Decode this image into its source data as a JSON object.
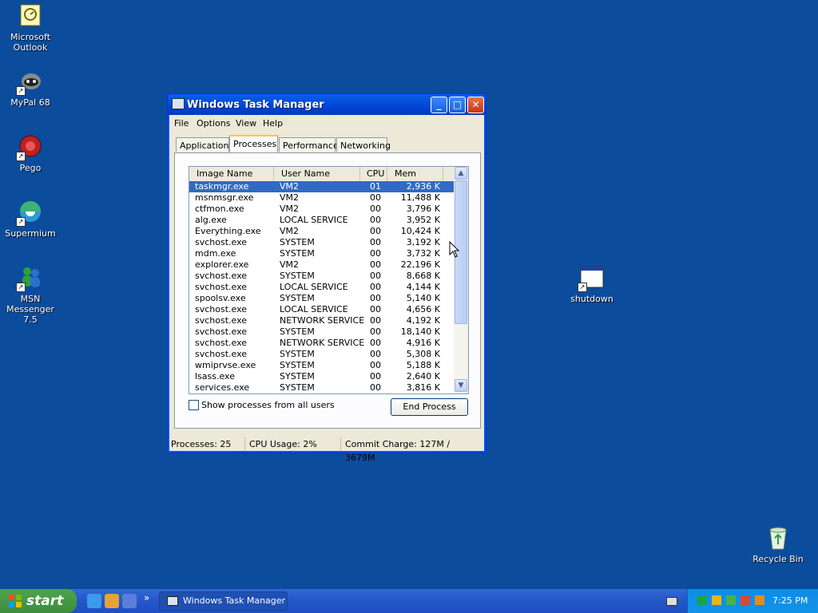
{
  "desktop": {
    "icons": [
      {
        "label_1": "Microsoft",
        "label_2": "Outlook",
        "icon": "outlook-icon"
      },
      {
        "label_1": "MyPal 68",
        "label_2": "",
        "icon": "mypal-icon"
      },
      {
        "label_1": "Pego",
        "label_2": "",
        "icon": "pego-icon"
      },
      {
        "label_1": "Supermium",
        "label_2": "",
        "icon": "supermium-icon"
      },
      {
        "label_1": "MSN",
        "label_2": "Messenger 7.5",
        "icon": "msn-messenger-icon"
      }
    ],
    "shutdown_label": "shutdown",
    "recycle_label": "Recycle Bin"
  },
  "window": {
    "title": "Windows Task Manager",
    "menu": [
      "File",
      "Options",
      "View",
      "Help"
    ],
    "tabs": [
      "Applications",
      "Processes",
      "Performance",
      "Networking"
    ],
    "active_tab": "Processes",
    "columns": [
      "Image Name",
      "User Name",
      "CPU",
      "Mem Usage"
    ],
    "processes": [
      {
        "name": "taskmgr.exe",
        "user": "VM2",
        "cpu": "01",
        "mem": "2,936 K"
      },
      {
        "name": "msnmsgr.exe",
        "user": "VM2",
        "cpu": "00",
        "mem": "11,488 K"
      },
      {
        "name": "ctfmon.exe",
        "user": "VM2",
        "cpu": "00",
        "mem": "3,796 K"
      },
      {
        "name": "alg.exe",
        "user": "LOCAL SERVICE",
        "cpu": "00",
        "mem": "3,952 K"
      },
      {
        "name": "Everything.exe",
        "user": "VM2",
        "cpu": "00",
        "mem": "10,424 K"
      },
      {
        "name": "svchost.exe",
        "user": "SYSTEM",
        "cpu": "00",
        "mem": "3,192 K"
      },
      {
        "name": "mdm.exe",
        "user": "SYSTEM",
        "cpu": "00",
        "mem": "3,732 K"
      },
      {
        "name": "explorer.exe",
        "user": "VM2",
        "cpu": "00",
        "mem": "22,196 K"
      },
      {
        "name": "svchost.exe",
        "user": "SYSTEM",
        "cpu": "00",
        "mem": "8,668 K"
      },
      {
        "name": "svchost.exe",
        "user": "LOCAL SERVICE",
        "cpu": "00",
        "mem": "4,144 K"
      },
      {
        "name": "spoolsv.exe",
        "user": "SYSTEM",
        "cpu": "00",
        "mem": "5,140 K"
      },
      {
        "name": "svchost.exe",
        "user": "LOCAL SERVICE",
        "cpu": "00",
        "mem": "4,656 K"
      },
      {
        "name": "svchost.exe",
        "user": "NETWORK SERVICE",
        "cpu": "00",
        "mem": "4,192 K"
      },
      {
        "name": "svchost.exe",
        "user": "SYSTEM",
        "cpu": "00",
        "mem": "18,140 K"
      },
      {
        "name": "svchost.exe",
        "user": "NETWORK SERVICE",
        "cpu": "00",
        "mem": "4,916 K"
      },
      {
        "name": "svchost.exe",
        "user": "SYSTEM",
        "cpu": "00",
        "mem": "5,308 K"
      },
      {
        "name": "wmiprvse.exe",
        "user": "SYSTEM",
        "cpu": "00",
        "mem": "5,188 K"
      },
      {
        "name": "lsass.exe",
        "user": "SYSTEM",
        "cpu": "00",
        "mem": "2,640 K"
      },
      {
        "name": "services.exe",
        "user": "SYSTEM",
        "cpu": "00",
        "mem": "3,816 K"
      }
    ],
    "show_all_label": "Show processes from all users",
    "show_all_checked": false,
    "end_process_label": "End Process",
    "status": {
      "processes": "Processes: 25",
      "cpu": "CPU Usage: 2%",
      "commit": "Commit Charge: 127M / 3679M"
    }
  },
  "taskbar": {
    "start_label": "start",
    "task_label": "Windows Task Manager",
    "clock": "7:25 PM"
  },
  "colors": {
    "desktop": "#0c4c9c",
    "title_bar": "#0045d6",
    "selection": "#316ac5",
    "start_button": "#3c8d3c"
  }
}
